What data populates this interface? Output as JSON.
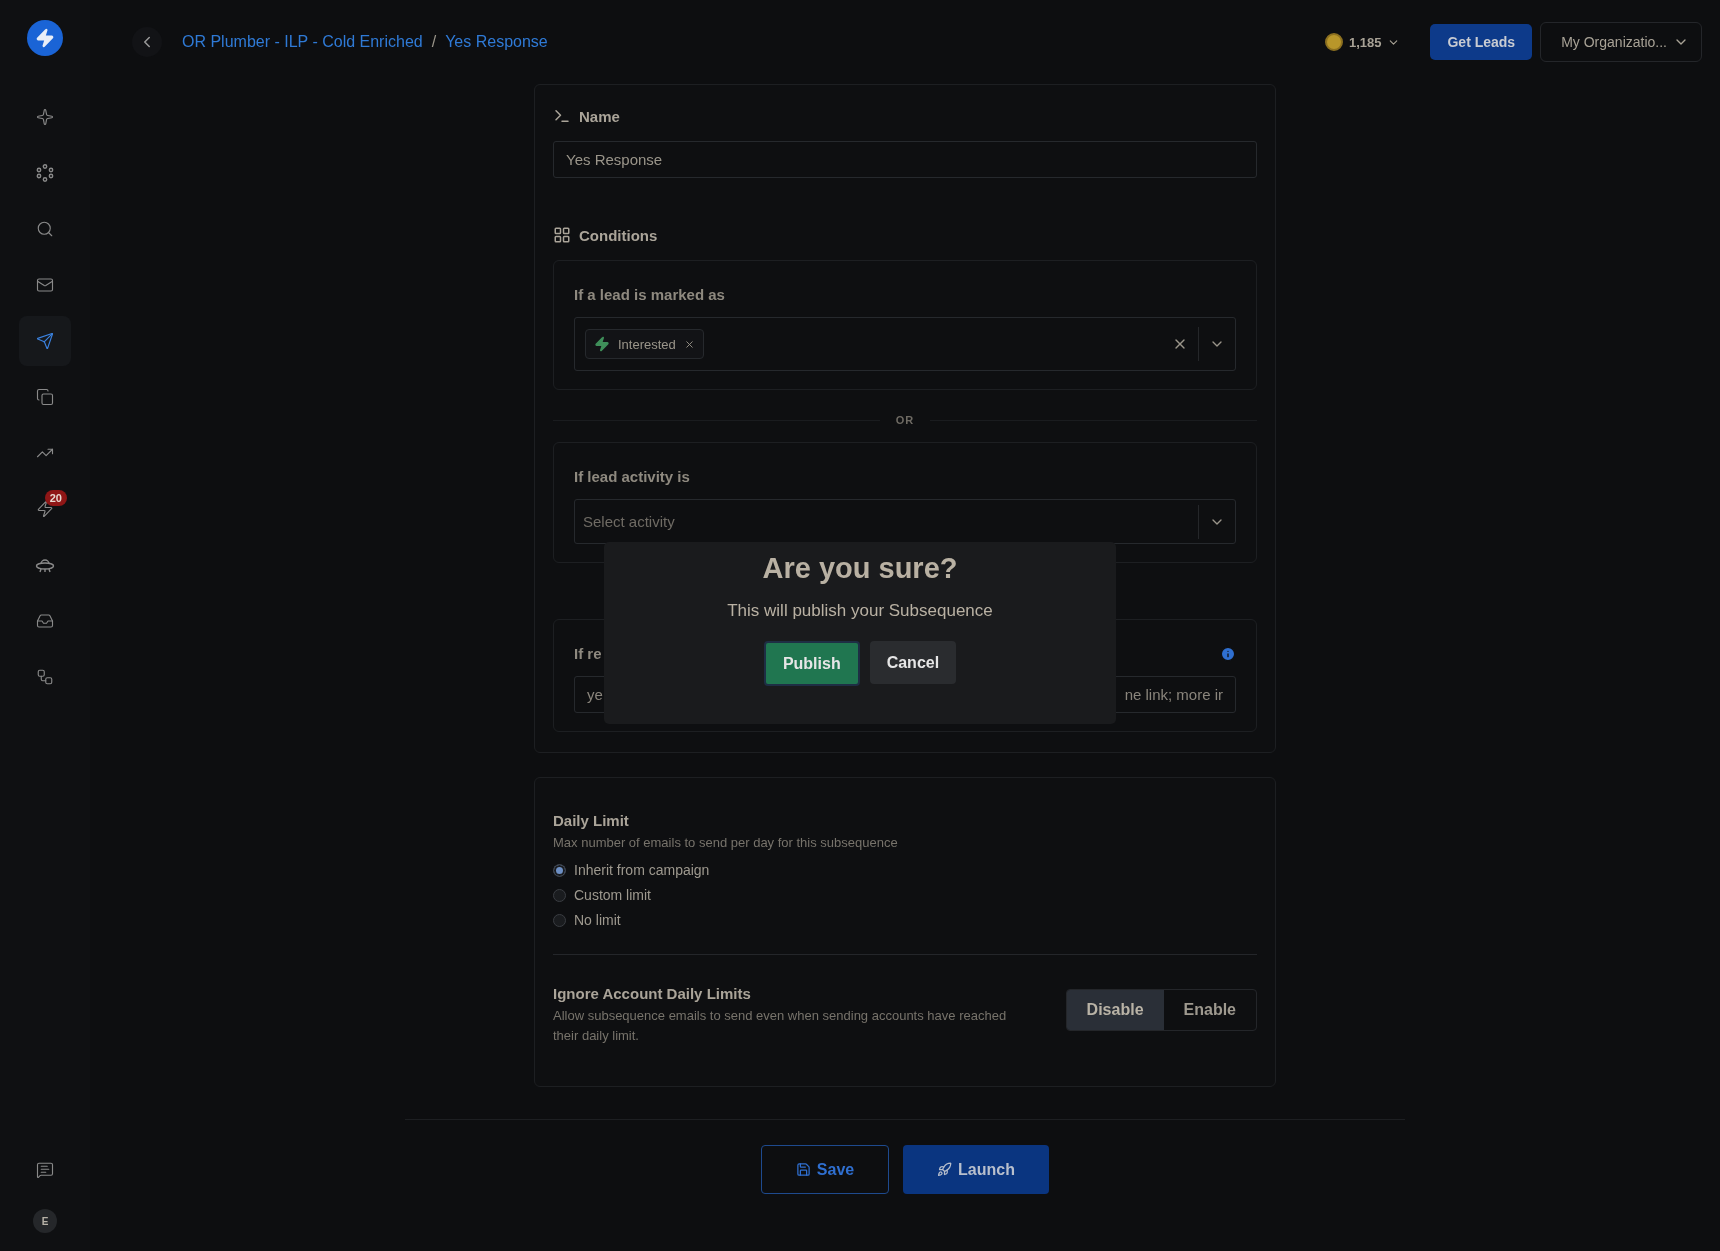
{
  "sidebar": {
    "items": [
      {
        "kind": "sparkle",
        "selected": false
      },
      {
        "kind": "dots",
        "selected": false
      },
      {
        "kind": "search",
        "selected": false
      },
      {
        "kind": "mail",
        "selected": false
      },
      {
        "kind": "send",
        "selected": true
      },
      {
        "kind": "copy",
        "selected": false
      },
      {
        "kind": "trend",
        "selected": false
      },
      {
        "kind": "zap",
        "selected": false,
        "badge": "20"
      },
      {
        "kind": "ufo",
        "selected": false
      },
      {
        "kind": "inbox",
        "selected": false
      },
      {
        "kind": "workflow",
        "selected": false
      }
    ],
    "bottom": [
      {
        "kind": "chat",
        "selected": false
      }
    ],
    "avatar": "E"
  },
  "header": {
    "breadcrumb": [
      "OR Plumber - ILP - Cold Enriched",
      "Yes Response"
    ],
    "separator": "/",
    "credits": "1,185",
    "get_leads": "Get Leads",
    "organization": "My Organizatio..."
  },
  "form": {
    "name": {
      "title": "Name",
      "value": "Yes Response"
    },
    "conditions": {
      "title": "Conditions",
      "marked": {
        "label": "If a lead is marked as",
        "tags": [
          {
            "label": "Interested"
          }
        ]
      },
      "divider": "OR",
      "activity": {
        "label": "If lead activity is",
        "placeholder": "Select activity"
      },
      "reply": {
        "label": "If re",
        "value_left": "ye",
        "value_right": "ne link; more ir"
      }
    }
  },
  "daily_limit": {
    "title": "Daily Limit",
    "description": "Max number of emails to send per day for this subsequence",
    "options": [
      {
        "label": "Inherit from campaign",
        "selected": true
      },
      {
        "label": "Custom limit",
        "selected": false
      },
      {
        "label": "No limit",
        "selected": false
      }
    ]
  },
  "ignore_limits": {
    "title": "Ignore Account Daily Limits",
    "description": "Allow subsequence emails to send even when sending accounts have reached their daily limit.",
    "toggle": [
      {
        "label": "Disable",
        "selected": true
      },
      {
        "label": "Enable",
        "selected": false
      }
    ]
  },
  "footer": {
    "save": "Save",
    "launch": "Launch"
  },
  "dialog": {
    "title": "Are you sure?",
    "message": "This will publish your Subsequence",
    "confirm": "Publish",
    "cancel": "Cancel"
  }
}
